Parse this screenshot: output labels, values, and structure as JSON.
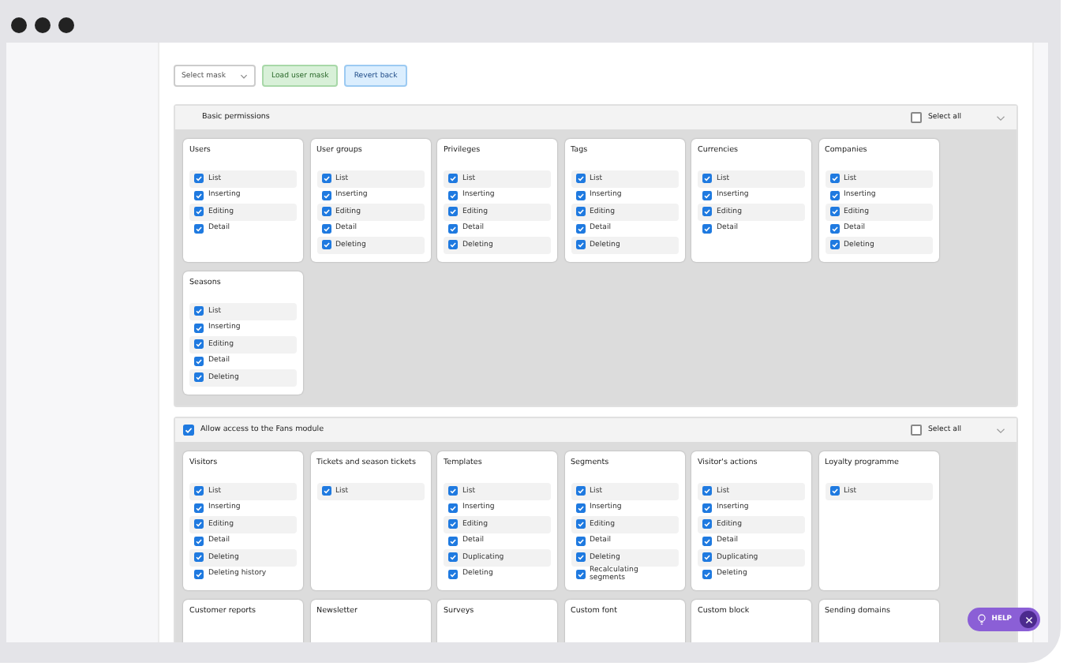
{
  "toolbar": {
    "mask_select": {
      "placeholder": "Select mask"
    },
    "buttons": [
      {
        "label": "Load user mask",
        "kind": "success"
      },
      {
        "label": "Revert back",
        "kind": "info"
      }
    ]
  },
  "sections": [
    {
      "title": "Basic permissions",
      "select_all": {
        "label": "Select all",
        "checked": false
      },
      "cards": [
        {
          "title": "Users",
          "items": [
            {
              "label": "List",
              "checked": true
            },
            {
              "label": "Inserting",
              "checked": true
            },
            {
              "label": "Editing",
              "checked": true
            },
            {
              "label": "Detail",
              "checked": true
            }
          ]
        },
        {
          "title": "User groups",
          "items": [
            {
              "label": "List",
              "checked": true
            },
            {
              "label": "Inserting",
              "checked": true
            },
            {
              "label": "Editing",
              "checked": true
            },
            {
              "label": "Detail",
              "checked": true
            },
            {
              "label": "Deleting",
              "checked": true
            }
          ]
        },
        {
          "title": "Privileges",
          "items": [
            {
              "label": "List",
              "checked": true
            },
            {
              "label": "Inserting",
              "checked": true
            },
            {
              "label": "Editing",
              "checked": true
            },
            {
              "label": "Detail",
              "checked": true
            },
            {
              "label": "Deleting",
              "checked": true
            }
          ]
        },
        {
          "title": "Tags",
          "items": [
            {
              "label": "List",
              "checked": true
            },
            {
              "label": "Inserting",
              "checked": true
            },
            {
              "label": "Editing",
              "checked": true
            },
            {
              "label": "Detail",
              "checked": true
            },
            {
              "label": "Deleting",
              "checked": true
            }
          ]
        },
        {
          "title": "Currencies",
          "items": [
            {
              "label": "List",
              "checked": true
            },
            {
              "label": "Inserting",
              "checked": true
            },
            {
              "label": "Editing",
              "checked": true
            },
            {
              "label": "Detail",
              "checked": true
            }
          ]
        },
        {
          "title": "Companies",
          "items": [
            {
              "label": "List",
              "checked": true
            },
            {
              "label": "Inserting",
              "checked": true
            },
            {
              "label": "Editing",
              "checked": true
            },
            {
              "label": "Detail",
              "checked": true
            },
            {
              "label": "Deleting",
              "checked": true
            }
          ]
        },
        {
          "title": "Seasons",
          "items": [
            {
              "label": "List",
              "checked": true
            },
            {
              "label": "Inserting",
              "checked": true
            },
            {
              "label": "Editing",
              "checked": true
            },
            {
              "label": "Detail",
              "checked": true
            },
            {
              "label": "Deleting",
              "checked": true
            }
          ]
        }
      ]
    },
    {
      "title": "Allow access to the Fans module",
      "checked": true,
      "select_all": {
        "label": "Select all",
        "checked": false
      },
      "cards": [
        {
          "title": "Visitors",
          "items": [
            {
              "label": "List",
              "checked": true
            },
            {
              "label": "Inserting",
              "checked": true
            },
            {
              "label": "Editing",
              "checked": true
            },
            {
              "label": "Detail",
              "checked": true
            },
            {
              "label": "Deleting",
              "checked": true
            },
            {
              "label": "Deleting history",
              "checked": true
            }
          ]
        },
        {
          "title": "Tickets and season tickets",
          "items": [
            {
              "label": "List",
              "checked": true
            }
          ]
        },
        {
          "title": "Templates",
          "items": [
            {
              "label": "List",
              "checked": true
            },
            {
              "label": "Inserting",
              "checked": true
            },
            {
              "label": "Editing",
              "checked": true
            },
            {
              "label": "Detail",
              "checked": true
            },
            {
              "label": "Duplicating",
              "checked": true
            },
            {
              "label": "Deleting",
              "checked": true
            }
          ]
        },
        {
          "title": "Segments",
          "items": [
            {
              "label": "List",
              "checked": true
            },
            {
              "label": "Inserting",
              "checked": true
            },
            {
              "label": "Editing",
              "checked": true
            },
            {
              "label": "Detail",
              "checked": true
            },
            {
              "label": "Deleting",
              "checked": true
            },
            {
              "label": "Recalculating segments",
              "checked": true
            }
          ]
        },
        {
          "title": "Visitor's actions",
          "items": [
            {
              "label": "List",
              "checked": true
            },
            {
              "label": "Inserting",
              "checked": true
            },
            {
              "label": "Editing",
              "checked": true
            },
            {
              "label": "Detail",
              "checked": true
            },
            {
              "label": "Duplicating",
              "checked": true
            },
            {
              "label": "Deleting",
              "checked": true
            }
          ]
        },
        {
          "title": "Loyalty programme",
          "items": [
            {
              "label": "List",
              "checked": true
            }
          ]
        },
        {
          "title": "Customer reports"
        },
        {
          "title": "Newsletter"
        },
        {
          "title": "Surveys"
        },
        {
          "title": "Custom font"
        },
        {
          "title": "Custom block"
        },
        {
          "title": "Sending domains"
        }
      ]
    }
  ],
  "help_button": {
    "label": "HELP"
  }
}
